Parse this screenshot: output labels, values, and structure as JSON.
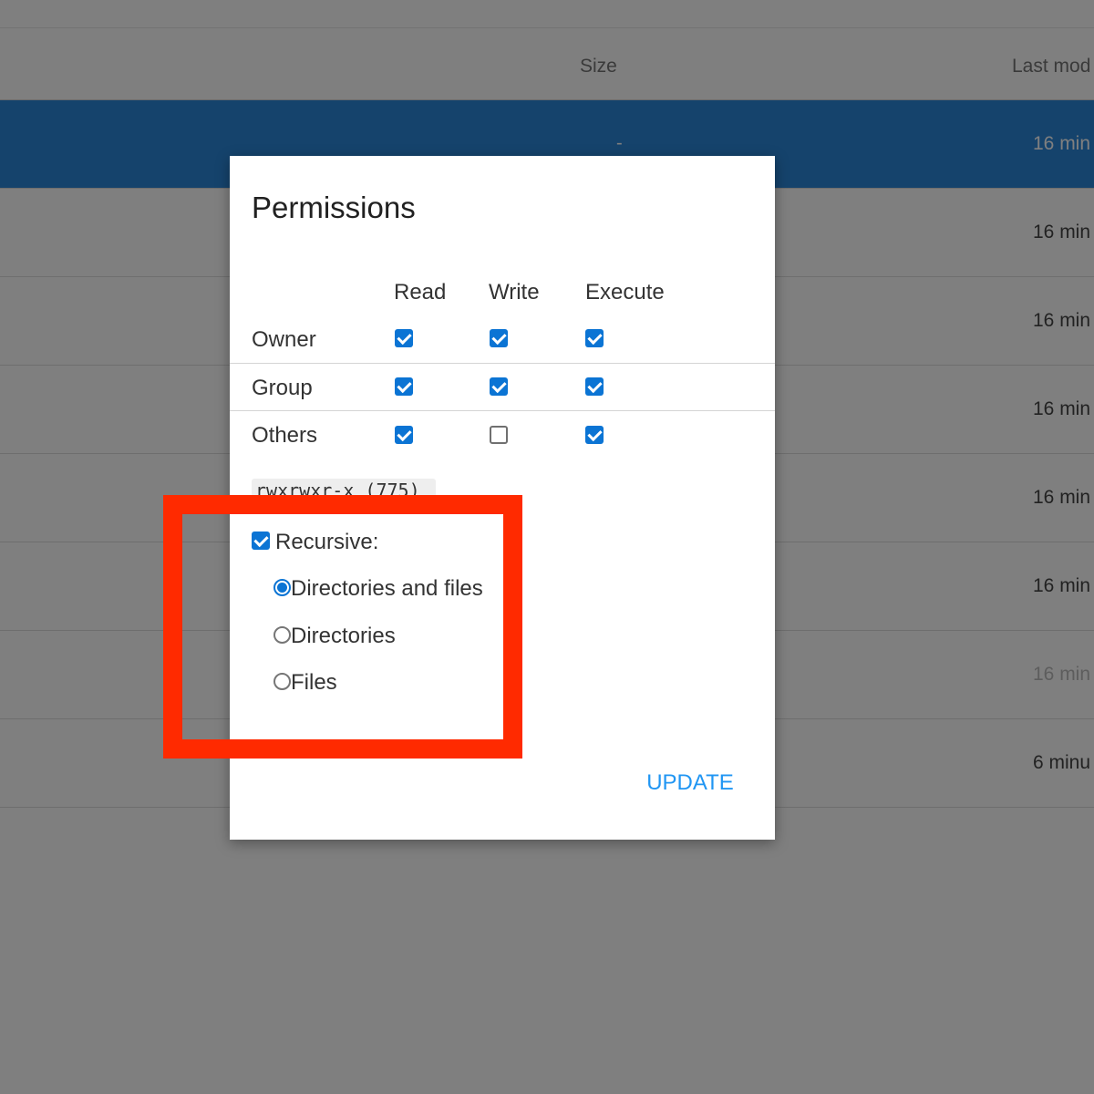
{
  "file_list": {
    "columns": {
      "size": "Size",
      "last_modified": "Last mod"
    },
    "rows": [
      {
        "size": "-",
        "modified": "16 min",
        "selected": true
      },
      {
        "size": "",
        "modified": "16 min"
      },
      {
        "size": "",
        "modified": "16 min"
      },
      {
        "size": "",
        "modified": "16 min"
      },
      {
        "size": "",
        "modified": "16 min"
      },
      {
        "size": "",
        "modified": "16 min"
      },
      {
        "size": "",
        "modified": "16 min"
      },
      {
        "size": "",
        "modified": "6 minu"
      }
    ]
  },
  "dialog": {
    "title": "Permissions",
    "columns": {
      "read": "Read",
      "write": "Write",
      "execute": "Execute"
    },
    "rows": [
      {
        "label": "Owner",
        "read": true,
        "write": true,
        "execute": true
      },
      {
        "label": "Group",
        "read": true,
        "write": true,
        "execute": true
      },
      {
        "label": "Others",
        "read": true,
        "write": false,
        "execute": true
      }
    ],
    "mode_text": "rwxrwxr-x (775)",
    "recursive": {
      "label": "Recursive:",
      "checked": true
    },
    "recursive_options": [
      {
        "label": "Directories and files",
        "selected": true
      },
      {
        "label": "Directories",
        "selected": false
      },
      {
        "label": "Files",
        "selected": false
      }
    ],
    "update_label": "UPDATE"
  },
  "colors": {
    "accent": "#0b74d4",
    "button_text": "#2196f3",
    "highlight": "#ff2a00",
    "selected_row": "#2b86d9"
  }
}
